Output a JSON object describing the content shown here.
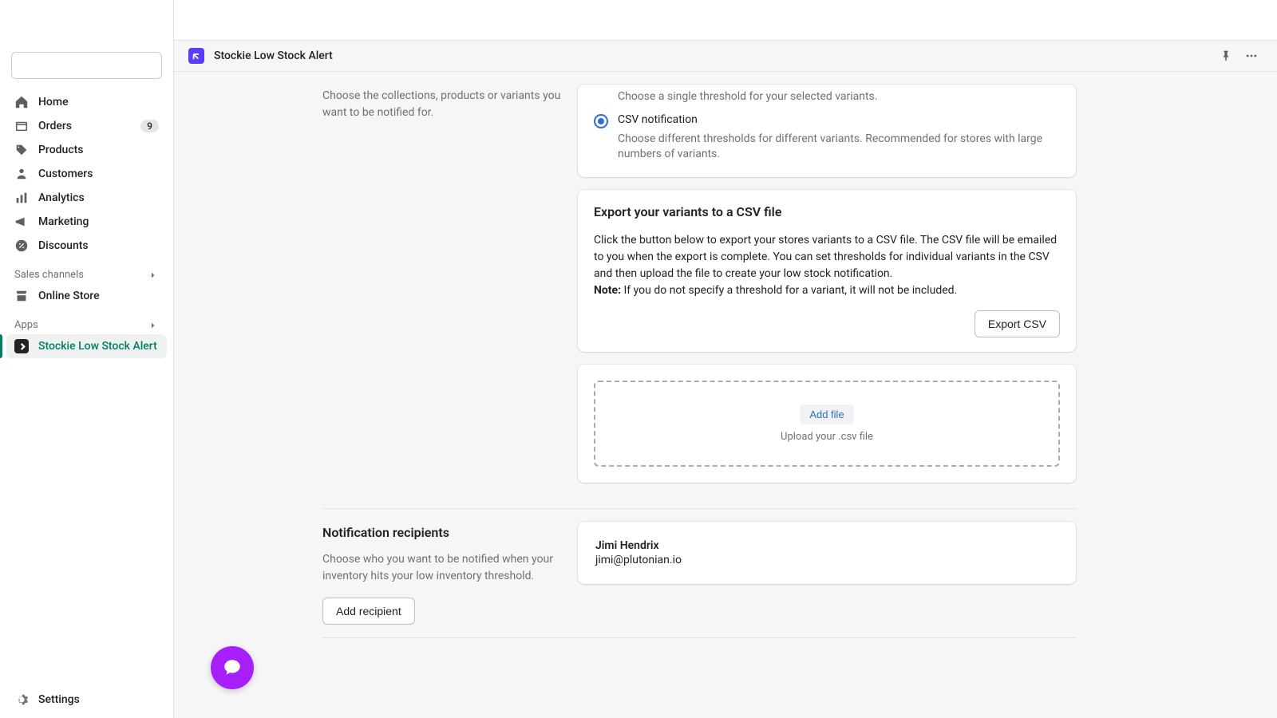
{
  "sidebar": {
    "nav": [
      {
        "label": "Home"
      },
      {
        "label": "Orders",
        "badge": "9"
      },
      {
        "label": "Products"
      },
      {
        "label": "Customers"
      },
      {
        "label": "Analytics"
      },
      {
        "label": "Marketing"
      },
      {
        "label": "Discounts"
      }
    ],
    "section_sales": "Sales channels",
    "online_store": "Online Store",
    "section_apps": "Apps",
    "app_item": "Stockie Low Stock Alert",
    "settings": "Settings"
  },
  "header": {
    "title": "Stockie Low Stock Alert"
  },
  "section_products": {
    "desc": "Choose the collections, products or variants you want to be notified for."
  },
  "notification_type": {
    "option1_desc": "Choose a single threshold for your selected variants.",
    "option2_label": "CSV notification",
    "option2_desc": "Choose different thresholds for different variants. Recommended for stores with large numbers of variants."
  },
  "export_card": {
    "heading": "Export your variants to a CSV file",
    "text": "Click the button below to export your stores variants to a CSV file. The CSV file will be emailed to you when the export is complete. You can set thresholds for individual variants in the CSV and then upload the file to create your low stock notification.",
    "note_label": "Note:",
    "note_text": " If you do not specify a threshold for a variant, it will not be included.",
    "button": "Export CSV"
  },
  "upload_card": {
    "add_file": "Add file",
    "hint": "Upload your .csv file"
  },
  "recipients_section": {
    "title": "Notification recipients",
    "desc": "Choose who you want to be notified when your inventory hits your low inventory threshold.",
    "add_button": "Add recipient",
    "recipient_name": "Jimi Hendrix",
    "recipient_email": "jimi@plutonian.io"
  }
}
